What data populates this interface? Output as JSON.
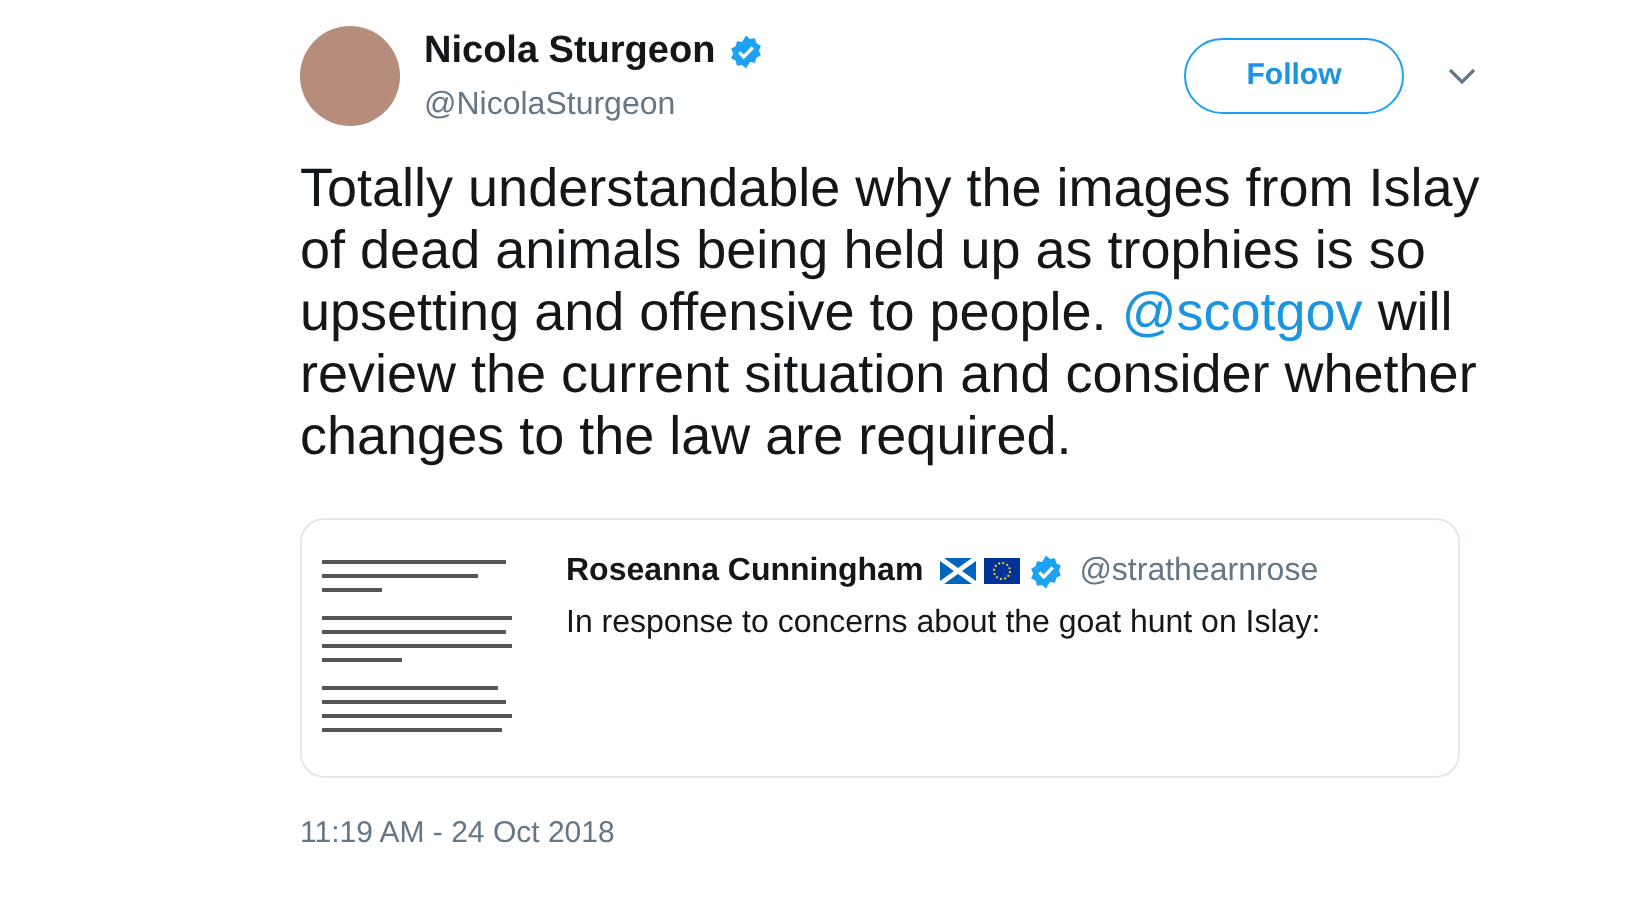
{
  "author": {
    "name": "Nicola Sturgeon",
    "handle": "@NicolaSturgeon",
    "verified": true
  },
  "follow_button": {
    "label": "Follow"
  },
  "tweet": {
    "text_before": "Totally understandable why the images from Islay of dead animals being held up as trophies is so upsetting and offensive to people.",
    "mention": "@scotgov",
    "text_after": "will review the current situation and consider whether changes to the law are required."
  },
  "quoted_tweet": {
    "name": "Roseanna Cunningham",
    "verified": true,
    "handle": "@strathearnrose",
    "text": "In response to concerns about the goat hunt on Islay:"
  },
  "timestamp": "11:19 AM - 24 Oct 2018"
}
